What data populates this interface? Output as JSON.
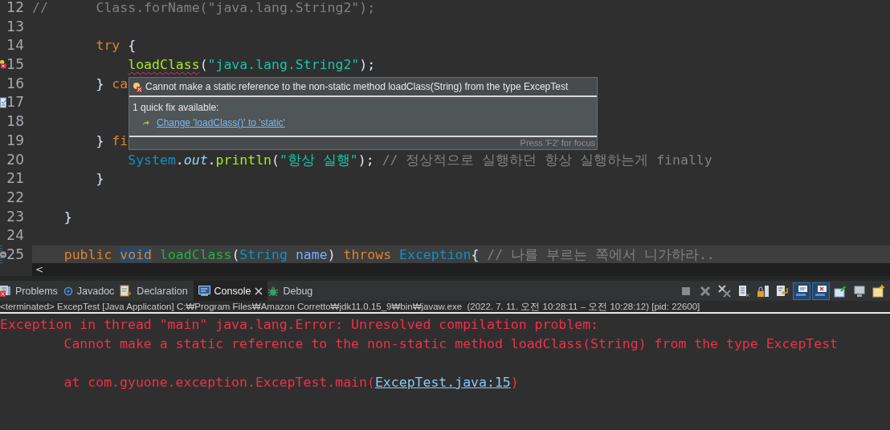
{
  "editor": {
    "lines": [
      {
        "number": "12",
        "current": false,
        "tokens": [
          {
            "text": "//      Class.forName(\"java.lang.String2\");",
            "kind": "comment"
          }
        ]
      },
      {
        "number": "13",
        "current": false
      },
      {
        "number": "14",
        "current": false,
        "tokens": [
          {
            "text": "        try",
            "kind": "keyword"
          },
          {
            "text": " {",
            "kind": "plain"
          }
        ]
      },
      {
        "number": "15",
        "current": false,
        "kind": "error",
        "tokens": [
          {
            "text": "            loadClass",
            "kind": "error_call"
          },
          {
            "text": "(",
            "kind": "plain"
          },
          {
            "text": "\"java.lang.String2\"",
            "kind": "string"
          },
          {
            "text": ");",
            "kind": "plain"
          }
        ]
      },
      {
        "number": "16",
        "current": false,
        "tokens": [
          {
            "text": "        } ",
            "kind": "plain"
          },
          {
            "text": "ca",
            "kind": "keyword"
          }
        ]
      },
      {
        "number": "17",
        "current": false,
        "kind": "task"
      },
      {
        "number": "18",
        "current": false
      },
      {
        "number": "19",
        "current": false,
        "tokens": [
          {
            "text": "        } ",
            "kind": "plain"
          },
          {
            "text": "fi",
            "kind": "keyword"
          }
        ]
      },
      {
        "number": "20",
        "current": false,
        "tokens": [
          {
            "text": "            System",
            "kind": "type"
          },
          {
            "text": ".",
            "kind": "plain"
          },
          {
            "text": "out",
            "kind": "field"
          },
          {
            "text": ".",
            "kind": "plain"
          },
          {
            "text": "println",
            "kind": "call"
          },
          {
            "text": "(",
            "kind": "plain"
          },
          {
            "text": "\"항상 실행\"",
            "kind": "string"
          },
          {
            "text": "); ",
            "kind": "plain"
          },
          {
            "text": "// 정상적으로 실행하던 항상 실행하는게 finally",
            "kind": "comment"
          }
        ]
      },
      {
        "number": "21",
        "current": false,
        "tokens": [
          {
            "text": "        }",
            "kind": "plain"
          }
        ]
      },
      {
        "number": "22",
        "current": false
      },
      {
        "number": "23",
        "current": false,
        "tokens": [
          {
            "text": "    }",
            "kind": "plain"
          }
        ]
      },
      {
        "number": "24",
        "current": false
      },
      {
        "number": "25",
        "current": true,
        "kind": "fold",
        "tokens": [
          {
            "text": "    public",
            "kind": "keyword"
          },
          {
            "text": " void",
            "kind": "occurrence"
          },
          {
            "text": " loadClass",
            "kind": "declaration"
          },
          {
            "text": "(",
            "kind": "plain"
          },
          {
            "text": "String",
            "kind": "type"
          },
          {
            "text": " name",
            "kind": "param"
          },
          {
            "text": ") ",
            "kind": "plain"
          },
          {
            "text": "throws",
            "kind": "keyword"
          },
          {
            "text": " Exception",
            "kind": "type"
          },
          {
            "text": "{ ",
            "kind": "plain"
          },
          {
            "text": "// 나를 부르는 쪽에서 니가하라..",
            "kind": "comment"
          }
        ]
      }
    ],
    "hover": {
      "message": "Cannot make a static reference to the non-static method loadClass(String) from the type ExcepTest",
      "fix_count": "1 quick fix available:",
      "fixes": [
        {
          "label": "Change 'loadClass()' to 'static'"
        }
      ],
      "footer": "Press 'F2' for focus"
    },
    "scroll_arrow": "<"
  },
  "views": {
    "tabs": [
      {
        "label": "Problems",
        "kind": "problems",
        "selected": false
      },
      {
        "label": "Javadoc",
        "kind": "javadoc",
        "selected": false
      },
      {
        "label": "Declaration",
        "kind": "declaration",
        "selected": false
      },
      {
        "label": "Console",
        "kind": "console",
        "selected": true
      },
      {
        "label": "Debug",
        "kind": "debug",
        "selected": false
      }
    ],
    "toolbar": [
      {
        "kind": "stop",
        "on": false
      },
      {
        "kind": "remove",
        "on": false
      },
      {
        "kind": "remove_all",
        "on": false
      },
      {
        "kind": "clear",
        "on": false
      },
      {
        "kind": "scroll_lock",
        "on": false
      },
      {
        "kind": "word_wrap",
        "on": false
      },
      {
        "kind": "stdout",
        "on": true
      },
      {
        "kind": "stderr",
        "on": true
      },
      {
        "kind": "pin",
        "on": false
      },
      {
        "kind": "display",
        "on": false
      },
      {
        "kind": "new",
        "on": false
      }
    ]
  },
  "console": {
    "status": "<terminated> ExcepTest [Java Application] C:₩Program Files₩Amazon Corretto₩jdk11.0.15_9₩bin₩javaw.exe  (2022. 7. 11. 오전 10:28:11 – 오전 10:28:12) [pid: 22600]",
    "blocks": [
      [
        {
          "segments": [
            {
              "text": "Exception in thread \"main\" java.lang.Error: Unresolved compilation problem: ",
              "kind": "error"
            }
          ]
        },
        {
          "segments": [
            {
              "text": "        Cannot make a static reference to the non-static method loadClass(String) from the type ExcepTest",
              "kind": "error"
            }
          ]
        }
      ],
      [
        {
          "segments": [
            {
              "text": "        at com.gyuone.exception.ExcepTest.main(",
              "kind": "error"
            },
            {
              "text": "ExcepTest.java:15",
              "kind": "link"
            },
            {
              "text": ")",
              "kind": "error"
            }
          ]
        }
      ]
    ]
  }
}
